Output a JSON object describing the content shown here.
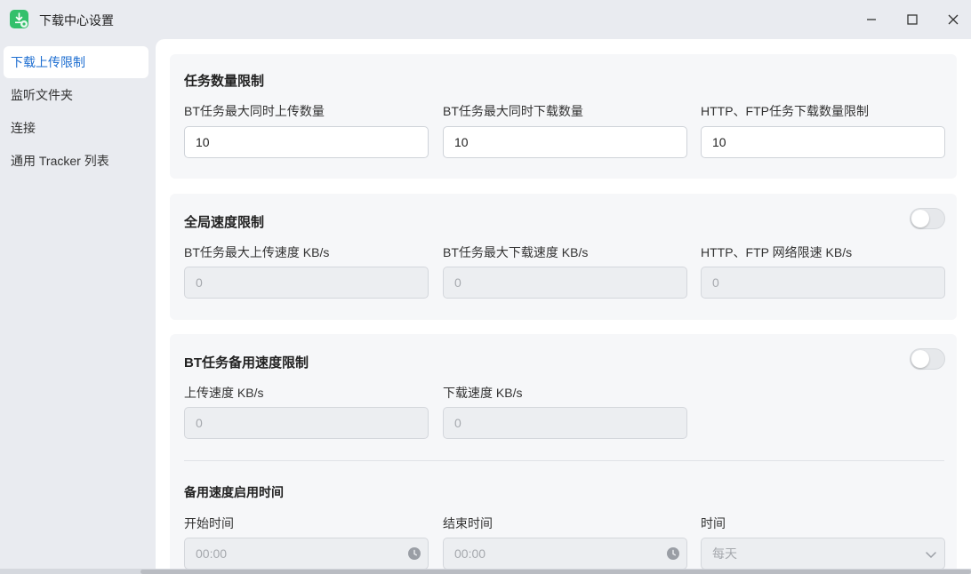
{
  "window": {
    "title": "下载中心设置",
    "controls": [
      "minimize-icon",
      "maximize-icon",
      "close-icon"
    ]
  },
  "sidebar": {
    "items": [
      {
        "label": "下载上传限制",
        "active": true
      },
      {
        "label": "监听文件夹",
        "active": false
      },
      {
        "label": "连接",
        "active": false
      },
      {
        "label": "通用 Tracker 列表",
        "active": false
      }
    ]
  },
  "sections": {
    "task_limit": {
      "title": "任务数量限制",
      "fields": [
        {
          "label": "BT任务最大同时上传数量",
          "value": "10"
        },
        {
          "label": "BT任务最大同时下载数量",
          "value": "10"
        },
        {
          "label": "HTTP、FTP任务下载数量限制",
          "value": "10"
        }
      ]
    },
    "global_speed": {
      "title": "全局速度限制",
      "toggle_on": false,
      "fields": [
        {
          "label": "BT任务最大上传速度 KB/s",
          "placeholder": "0"
        },
        {
          "label": "BT任务最大下载速度 KB/s",
          "placeholder": "0"
        },
        {
          "label": "HTTP、FTP 网络限速 KB/s",
          "placeholder": "0"
        }
      ]
    },
    "bt_backup_speed": {
      "title": "BT任务备用速度限制",
      "toggle_on": false,
      "fields": [
        {
          "label": "上传速度 KB/s",
          "placeholder": "0"
        },
        {
          "label": "下载速度 KB/s",
          "placeholder": "0"
        }
      ],
      "schedule": {
        "title": "备用速度启用时间",
        "start_label": "开始时间",
        "start_placeholder": "00:00",
        "end_label": "结束时间",
        "end_placeholder": "00:00",
        "time_label": "时间",
        "time_value": "每天"
      }
    }
  },
  "colors": {
    "accent": "#1f6fd1",
    "app_icon": "#33c06b"
  }
}
